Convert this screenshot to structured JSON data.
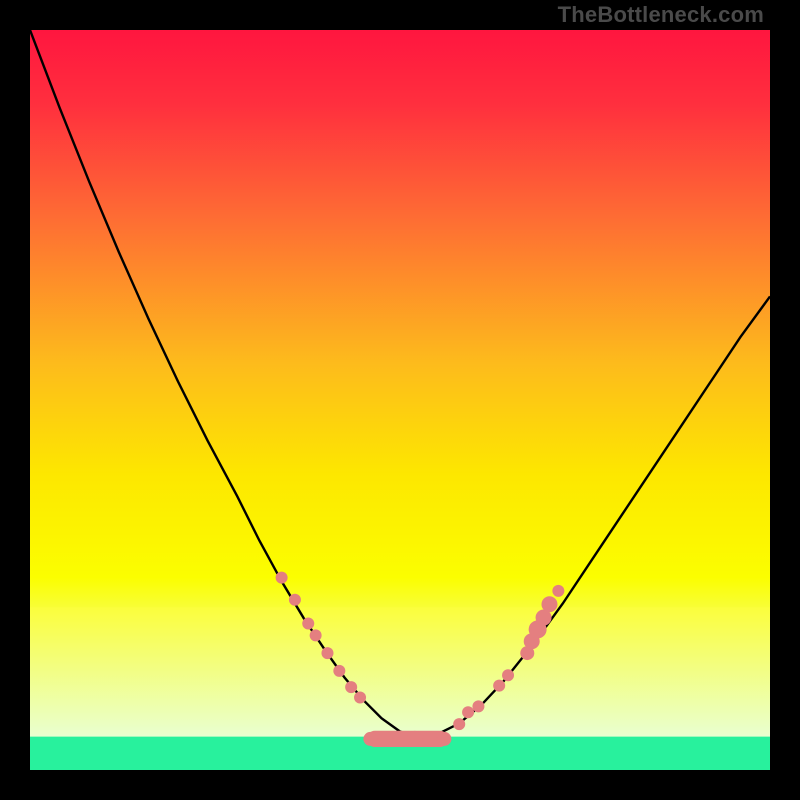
{
  "watermark": "TheBottleneck.com",
  "chart_data": {
    "type": "line",
    "title": "",
    "xlabel": "",
    "ylabel": "",
    "xlim": [
      0,
      100
    ],
    "ylim": [
      0,
      100
    ],
    "background_gradient": [
      {
        "stop": 0.0,
        "color": "#ff163f"
      },
      {
        "stop": 0.1,
        "color": "#ff2f3e"
      },
      {
        "stop": 0.25,
        "color": "#fe6b34"
      },
      {
        "stop": 0.45,
        "color": "#fdbb1c"
      },
      {
        "stop": 0.6,
        "color": "#fde700"
      },
      {
        "stop": 0.74,
        "color": "#fbfe00"
      },
      {
        "stop": 0.82,
        "color": "#f4ff6c"
      },
      {
        "stop": 0.88,
        "color": "#dbffa3"
      },
      {
        "stop": 0.94,
        "color": "#9dffb1"
      },
      {
        "stop": 1.0,
        "color": "#28f19d"
      }
    ],
    "green_band": {
      "y0": 95.5,
      "y1": 100,
      "color": "#28f19d"
    },
    "pale_band": {
      "y0": 78,
      "y1": 95.5,
      "color_top": "#fbfe3c",
      "color_bottom": "#e9ffd0"
    },
    "series": [
      {
        "name": "bottleneck-curve",
        "color": "#000000",
        "x": [
          0,
          4,
          8,
          12,
          16,
          20,
          24,
          28,
          31,
          34,
          37,
          40,
          42.5,
          45,
          47.5,
          50,
          52.5,
          55,
          58,
          61,
          64,
          68,
          72,
          76,
          80,
          84,
          88,
          92,
          96,
          100
        ],
        "y": [
          0,
          10.5,
          20.5,
          30,
          39,
          47.5,
          55.5,
          63,
          69,
          74.5,
          79.5,
          84,
          87.5,
          90.5,
          93,
          94.8,
          95.6,
          95.2,
          93.7,
          91.2,
          88,
          83,
          77.5,
          71.5,
          65.5,
          59.5,
          53.5,
          47.5,
          41.5,
          36
        ]
      }
    ],
    "markers": {
      "name": "sample-points",
      "color": "#e47f80",
      "radius_range": [
        5,
        9
      ],
      "points": [
        {
          "x": 34.0,
          "y": 74.0,
          "r": 6
        },
        {
          "x": 35.8,
          "y": 77.0,
          "r": 6
        },
        {
          "x": 37.6,
          "y": 80.2,
          "r": 6
        },
        {
          "x": 38.6,
          "y": 81.8,
          "r": 6
        },
        {
          "x": 40.2,
          "y": 84.2,
          "r": 6
        },
        {
          "x": 41.8,
          "y": 86.6,
          "r": 6
        },
        {
          "x": 43.4,
          "y": 88.8,
          "r": 6
        },
        {
          "x": 44.6,
          "y": 90.2,
          "r": 6
        },
        {
          "x": 46.0,
          "y": 95.8,
          "r": 7
        },
        {
          "x": 48.0,
          "y": 95.8,
          "r": 7
        },
        {
          "x": 50.0,
          "y": 95.8,
          "r": 8
        },
        {
          "x": 52.0,
          "y": 95.8,
          "r": 8
        },
        {
          "x": 54.0,
          "y": 95.8,
          "r": 7
        },
        {
          "x": 56.0,
          "y": 95.8,
          "r": 7
        },
        {
          "x": 58.0,
          "y": 93.8,
          "r": 6
        },
        {
          "x": 59.2,
          "y": 92.2,
          "r": 6
        },
        {
          "x": 60.6,
          "y": 91.4,
          "r": 6
        },
        {
          "x": 63.4,
          "y": 88.6,
          "r": 6
        },
        {
          "x": 64.6,
          "y": 87.2,
          "r": 6
        },
        {
          "x": 67.2,
          "y": 84.2,
          "r": 7
        },
        {
          "x": 67.8,
          "y": 82.6,
          "r": 8
        },
        {
          "x": 68.6,
          "y": 81.0,
          "r": 9
        },
        {
          "x": 69.4,
          "y": 79.4,
          "r": 8
        },
        {
          "x": 70.2,
          "y": 77.6,
          "r": 8
        },
        {
          "x": 71.4,
          "y": 75.8,
          "r": 6
        }
      ]
    },
    "bottom_bar": {
      "name": "plateau-bar",
      "color": "#e47f80",
      "x0": 45.5,
      "x1": 56.5,
      "y": 95.8,
      "height": 2.2
    }
  }
}
